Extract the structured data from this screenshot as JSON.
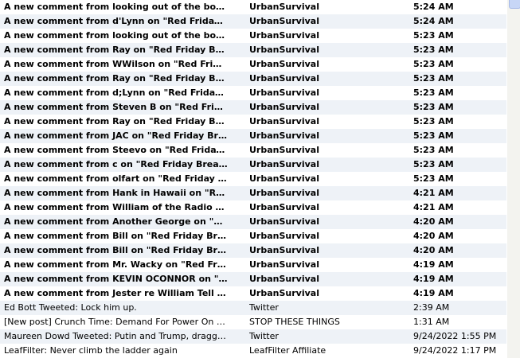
{
  "messages": [
    {
      "subject": "A new comment from looking out of the box on \"Red Friday Breakdown\"",
      "feed": "UrbanSurvival",
      "date": "5:24 AM",
      "bold": true
    },
    {
      "subject": "A new comment from d'Lynn on \"Red Friday Breakdown\"",
      "feed": "UrbanSurvival",
      "date": "5:24 AM",
      "bold": true
    },
    {
      "subject": "A new comment from looking out of the box on \"Red Friday Breakdown\"",
      "feed": "UrbanSurvival",
      "date": "5:23 AM",
      "bold": true
    },
    {
      "subject": "A new comment from Ray on \"Red Friday Breakdown\"",
      "feed": "UrbanSurvival",
      "date": "5:23 AM",
      "bold": true
    },
    {
      "subject": "A new comment from WWilson on \"Red Friday Breakdown\"",
      "feed": "UrbanSurvival",
      "date": "5:23 AM",
      "bold": true
    },
    {
      "subject": "A new comment from Ray on \"Red Friday Breakdown\"",
      "feed": "UrbanSurvival",
      "date": "5:23 AM",
      "bold": true
    },
    {
      "subject": "A new comment from d;Lynn on \"Red Friday Breakdown\"",
      "feed": "UrbanSurvival",
      "date": "5:23 AM",
      "bold": true
    },
    {
      "subject": "A new comment from Steven B on \"Red Friday Breakdown\"",
      "feed": "UrbanSurvival",
      "date": "5:23 AM",
      "bold": true
    },
    {
      "subject": "A new comment from Ray on \"Red Friday Breakdown\"",
      "feed": "UrbanSurvival",
      "date": "5:23 AM",
      "bold": true
    },
    {
      "subject": "A new comment from JAC on \"Red Friday Breakdown\"",
      "feed": "UrbanSurvival",
      "date": "5:23 AM",
      "bold": true
    },
    {
      "subject": "A new comment from Steevo on \"Red Friday Breakdown\"",
      "feed": "UrbanSurvival",
      "date": "5:23 AM",
      "bold": true
    },
    {
      "subject": "A new comment from c on \"Red Friday Breakdown\"",
      "feed": "UrbanSurvival",
      "date": "5:23 AM",
      "bold": true
    },
    {
      "subject": "A new comment from olfart on \"Red Friday Breakdown\"",
      "feed": "UrbanSurvival",
      "date": "5:23 AM",
      "bold": true
    },
    {
      "subject": "A new comment from Hank in Hawaii on \"Red Friday Breakdown\"",
      "feed": "UrbanSurvival",
      "date": "4:21 AM",
      "bold": true
    },
    {
      "subject": "A new comment from William of the Radio Ranch on \"Red Friday Breakdown\"",
      "feed": "UrbanSurvival",
      "date": "4:21 AM",
      "bold": true
    },
    {
      "subject": "A new comment from Another George on \"Red Friday Breakdown\"",
      "feed": "UrbanSurvival",
      "date": "4:20 AM",
      "bold": true
    },
    {
      "subject": "A new comment from Bill on \"Red Friday Breakdown\"",
      "feed": "UrbanSurvival",
      "date": "4:20 AM",
      "bold": true
    },
    {
      "subject": "A new comment from Bill on \"Red Friday Breakdown\"",
      "feed": "UrbanSurvival",
      "date": "4:20 AM",
      "bold": true
    },
    {
      "subject": "A new comment from Mr. Wacky on \"Red Friday Breakdown\"",
      "feed": "UrbanSurvival",
      "date": "4:19 AM",
      "bold": true
    },
    {
      "subject": "A new comment from KEVIN OCONNOR on \"Red Friday Breakdown\"",
      "feed": "UrbanSurvival",
      "date": "4:19 AM",
      "bold": true
    },
    {
      "subject": "A new comment from Jester re William Tell &amp; Red Friday Breakdown",
      "feed": "UrbanSurvival",
      "date": "4:19 AM",
      "bold": true
    },
    {
      "subject": "Ed Bott Tweeted: Lock him up.",
      "feed": "Twitter",
      "date": "2:39 AM",
      "bold": false
    },
    {
      "subject": "[New post] Crunch Time: Demand For Power On The Rise",
      "feed": "STOP THESE THINGS",
      "date": "1:31 AM",
      "bold": false
    },
    {
      "subject": "Maureen Dowd Tweeted: Putin and Trump, dragging us down",
      "feed": "Twitter",
      "date": "9/24/2022 1:55 PM",
      "bold": false
    },
    {
      "subject": "LeafFilter: Never  climb the  ladder again",
      "feed": "LeafFilter  Affiliate",
      "date": "9/24/2022 1:17 PM",
      "bold": false
    }
  ]
}
